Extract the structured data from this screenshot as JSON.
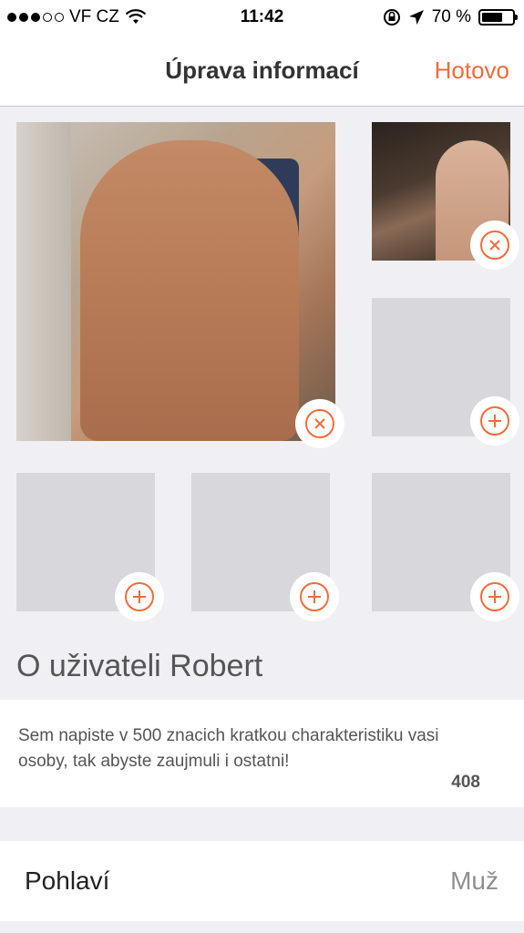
{
  "status_bar": {
    "carrier": "VF CZ",
    "time": "11:42",
    "battery": "70 %",
    "battery_level": 0.7,
    "signal_bars_filled": 3,
    "signal_bars_total": 5
  },
  "navbar": {
    "title": "Úprava informací",
    "done_label": "Hotovo"
  },
  "about": {
    "heading": "O uživateli Robert",
    "placeholder": "Sem napiste v 500 znacich kratkou charakteristiku vasi osoby, tak abyste zaujmuli i ostatni!",
    "remaining": "408"
  },
  "gender": {
    "label": "Pohlaví",
    "value": "Muž"
  },
  "colors": {
    "accent": "#f26b3a",
    "background": "#efeff4",
    "placeholder_tile": "#d8d8dc"
  }
}
